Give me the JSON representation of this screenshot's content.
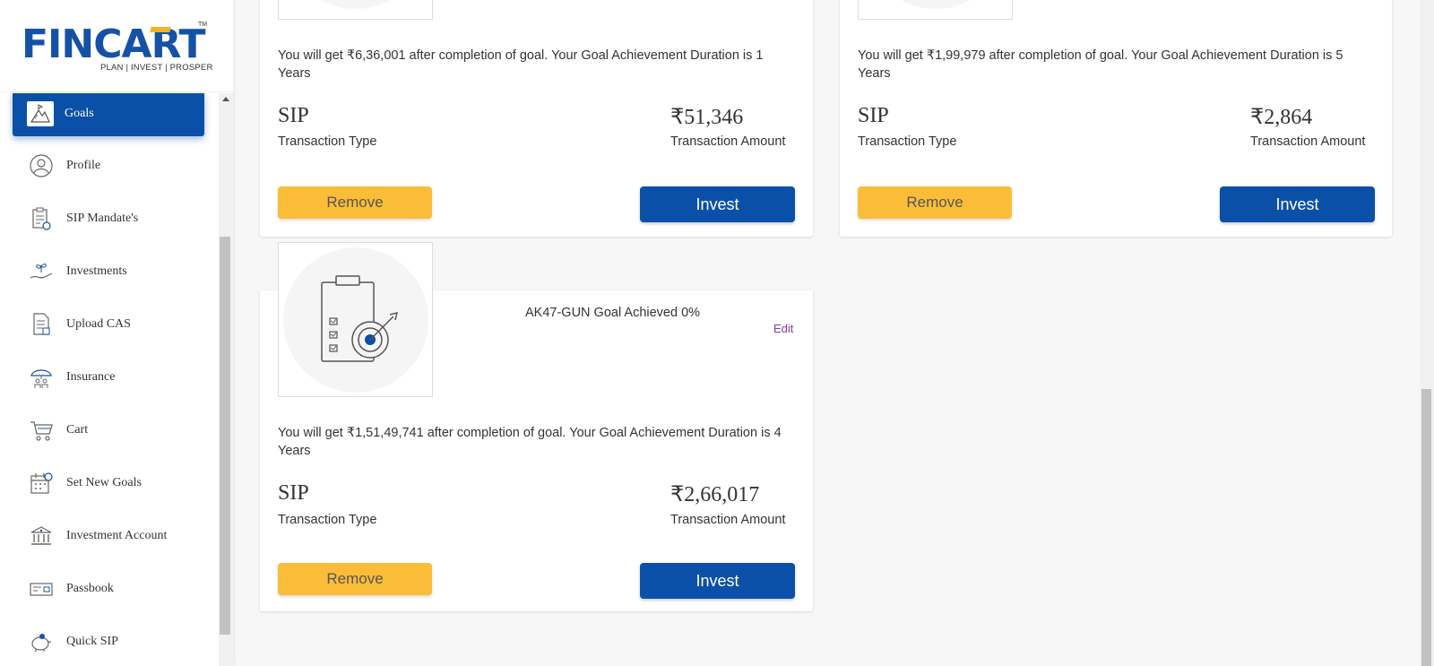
{
  "brand": {
    "logo_text": "FINCART",
    "tagline": "PLAN | INVEST | PROSPER",
    "tm": "TM",
    "accent": "#0a50a8",
    "highlight": "#fbbd38"
  },
  "sidebar": {
    "items": [
      {
        "label": "Goals",
        "icon": "mountain-flag-icon",
        "active": true
      },
      {
        "label": "Profile",
        "icon": "user-icon"
      },
      {
        "label": "SIP Mandate's",
        "icon": "clipboard-icon"
      },
      {
        "label": "Investments",
        "icon": "hand-plant-icon"
      },
      {
        "label": "Upload CAS",
        "icon": "document-upload-icon"
      },
      {
        "label": "Insurance",
        "icon": "umbrella-family-icon"
      },
      {
        "label": "Cart",
        "icon": "cart-icon"
      },
      {
        "label": "Set New Goals",
        "icon": "calendar-goal-icon"
      },
      {
        "label": "Investment Account",
        "icon": "bank-icon"
      },
      {
        "label": "Passbook",
        "icon": "passbook-icon"
      },
      {
        "label": "Quick SIP",
        "icon": "piggy-bank-icon"
      }
    ]
  },
  "cards": [
    {
      "description": "You will get ₹6,36,001 after completion of goal. Your Goal Achievement Duration is 1 Years",
      "transaction_type": "SIP",
      "transaction_type_label": "Transaction Type",
      "amount": "₹51,346",
      "amount_label": "Transaction Amount",
      "remove_label": "Remove",
      "invest_label": "Invest"
    },
    {
      "description": "You will get ₹1,99,979 after completion of goal. Your Goal Achievement Duration is 5 Years",
      "transaction_type": "SIP",
      "transaction_type_label": "Transaction Type",
      "amount": "₹2,864",
      "amount_label": "Transaction Amount",
      "remove_label": "Remove",
      "invest_label": "Invest"
    },
    {
      "title": "AK47-GUN Goal Achieved 0%",
      "edit_label": "Edit",
      "description": "You will get ₹1,51,49,741 after completion of goal. Your Goal Achievement Duration is 4 Years",
      "transaction_type": "SIP",
      "transaction_type_label": "Transaction Type",
      "amount": "₹2,66,017",
      "amount_label": "Transaction Amount",
      "remove_label": "Remove",
      "invest_label": "Invest",
      "image_icon": "clipboard-target-icon"
    }
  ]
}
